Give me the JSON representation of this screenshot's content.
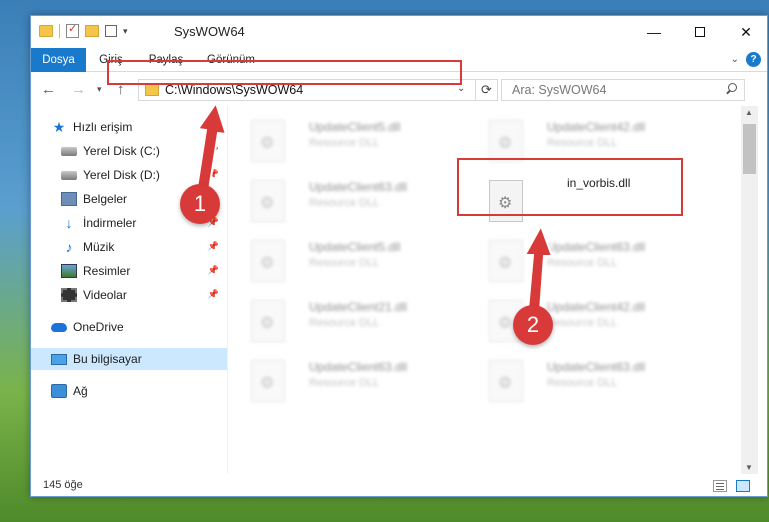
{
  "window": {
    "title": "SysWOW64",
    "minimize_glyph": "—",
    "close_glyph": "✕"
  },
  "ribbon": {
    "tabs": [
      {
        "label": "Dosya",
        "active": true
      },
      {
        "label": "Giriş"
      },
      {
        "label": "Paylaş"
      },
      {
        "label": "Görünüm"
      }
    ],
    "help": "?"
  },
  "nav": {
    "back_glyph": "←",
    "forward_glyph": "→",
    "recent_glyph": "▾",
    "up_glyph": "↑",
    "address": "C:\\Windows\\SysWOW64",
    "address_drop_glyph": "⌄",
    "refresh_glyph": "⟳",
    "search_placeholder": "Ara: SysWOW64"
  },
  "sidebar": {
    "items": [
      {
        "label": "Hızlı erişim",
        "icon": "star-icon"
      },
      {
        "label": "Yerel Disk (C:)",
        "icon": "disk-icon",
        "pinned": true
      },
      {
        "label": "Yerel Disk (D:)",
        "icon": "disk-icon",
        "pinned": true
      },
      {
        "label": "Belgeler",
        "icon": "documents-icon",
        "pinned": true
      },
      {
        "label": "İndirmeler",
        "icon": "download-icon",
        "pinned": true
      },
      {
        "label": "Müzik",
        "icon": "music-icon",
        "pinned": true
      },
      {
        "label": "Resimler",
        "icon": "pictures-icon",
        "pinned": true
      },
      {
        "label": "Videolar",
        "icon": "videos-icon",
        "pinned": true
      },
      {
        "label": "OneDrive",
        "icon": "onedrive-icon"
      },
      {
        "label": "Bu bilgisayar",
        "icon": "computer-icon",
        "selected": true
      },
      {
        "label": "Ağ",
        "icon": "network-icon"
      }
    ],
    "pin_glyph": "📌"
  },
  "files": [
    {
      "name": "UpdateClient5.dll",
      "type": "Resource DLL",
      "blurred": true
    },
    {
      "name": "UpdateClient42.dll",
      "type": "Resource DLL",
      "blurred": true
    },
    {
      "name": "UpdateClient63.dll",
      "type": "Resource DLL",
      "blurred": true
    },
    {
      "name": "in_vorbis.dll",
      "type": "",
      "blurred": false
    },
    {
      "name": "UpdateClient5.dll",
      "type": "Resource DLL",
      "blurred": true
    },
    {
      "name": "UpdateClient63.dll",
      "type": "Resource DLL",
      "blurred": true
    },
    {
      "name": "UpdateClient21.dll",
      "type": "Resource DLL",
      "blurred": true
    },
    {
      "name": "UpdateClient42.dll",
      "type": "Resource DLL",
      "blurred": true
    },
    {
      "name": "UpdateClient63.dll",
      "type": "Resource DLL",
      "blurred": true
    },
    {
      "name": "UpdateClient63.dll",
      "type": "Resource DLL",
      "blurred": true
    }
  ],
  "status": {
    "count": "145 öğe"
  },
  "annotations": {
    "step1": "1",
    "step2": "2",
    "color": "#d83a3a"
  },
  "scroll": {
    "up_glyph": "▲",
    "down_glyph": "▼"
  }
}
